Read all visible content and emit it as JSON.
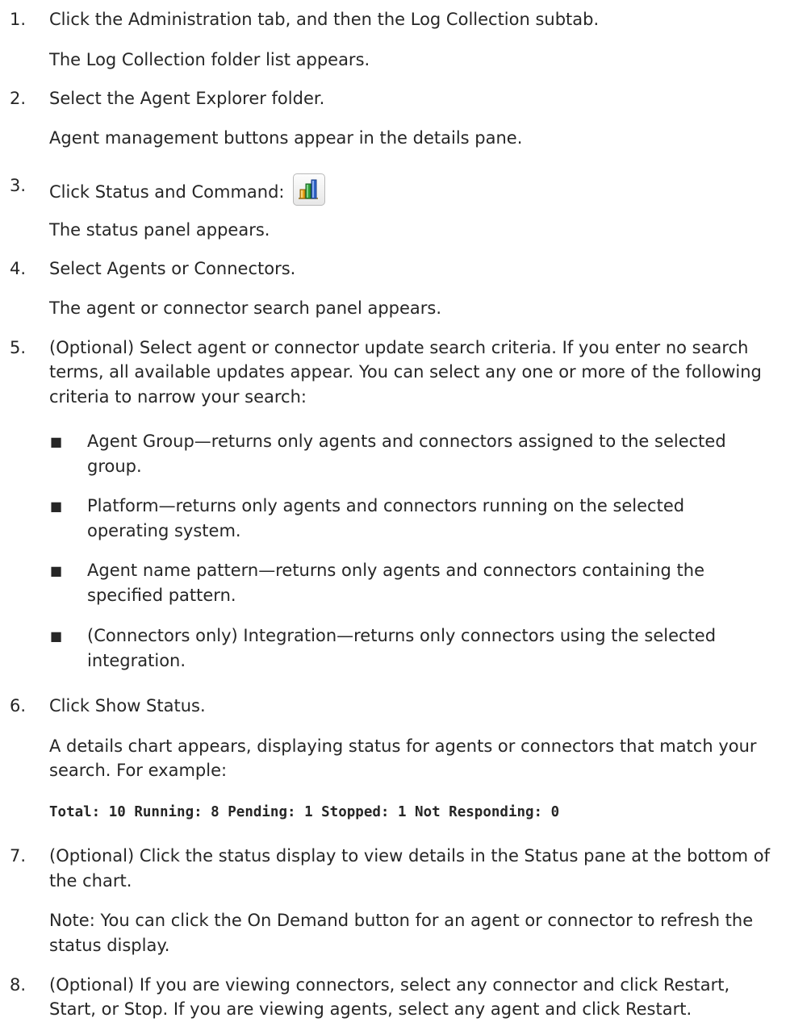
{
  "steps": [
    {
      "number": "1.",
      "text": "Click the Administration tab, and then the Log Collection subtab.",
      "result": "The Log Collection folder list appears."
    },
    {
      "number": "2.",
      "text": "Select the Agent Explorer folder.",
      "result": "Agent management buttons appear in the details pane."
    },
    {
      "number": "3.",
      "text": "Click Status and Command:",
      "icon": "status-and-command-icon",
      "result": "The status panel appears."
    },
    {
      "number": "4.",
      "text": "Select Agents or Connectors.",
      "result": "The agent or connector search panel appears."
    },
    {
      "number": "5.",
      "text_lines": [
        "(Optional) Select agent or connector update search criteria. If you enter no search",
        "terms, all available updates appear. You can select any one or more of the following",
        "criteria to narrow your search:"
      ]
    },
    {
      "number": "6.",
      "text": "Click Show Status.",
      "result_lines": [
        "A details chart appears, displaying status for agents or connectors that match your",
        "search. For example:"
      ],
      "code": "Total: 10 Running: 8 Pending: 1 Stopped: 1 Not Responding: 0"
    },
    {
      "number": "7.",
      "text_lines": [
        "(Optional) Click the status display to view details in the Status pane at the bottom of",
        "the chart."
      ],
      "note_lines": [
        "Note: You can click the On Demand button for an agent or connector to refresh the",
        "status display."
      ]
    },
    {
      "number": "8.",
      "text_lines": [
        "(Optional) If you are viewing connectors, select any connector and click Restart,",
        "Start, or Stop. If you are viewing agents, select any agent and click Restart."
      ]
    }
  ],
  "bullet_glyph": "■",
  "criteria": [
    {
      "lines": [
        "Agent Group—returns only agents and connectors assigned to the selected",
        "group."
      ]
    },
    {
      "lines": [
        "Platform—returns only agents and connectors running on the selected",
        "operating system."
      ]
    },
    {
      "lines": [
        "Agent name pattern—returns only agents and connectors containing the",
        "specified pattern."
      ]
    },
    {
      "lines": [
        "(Connectors only) Integration—returns only connectors using the selected",
        "integration."
      ]
    }
  ]
}
